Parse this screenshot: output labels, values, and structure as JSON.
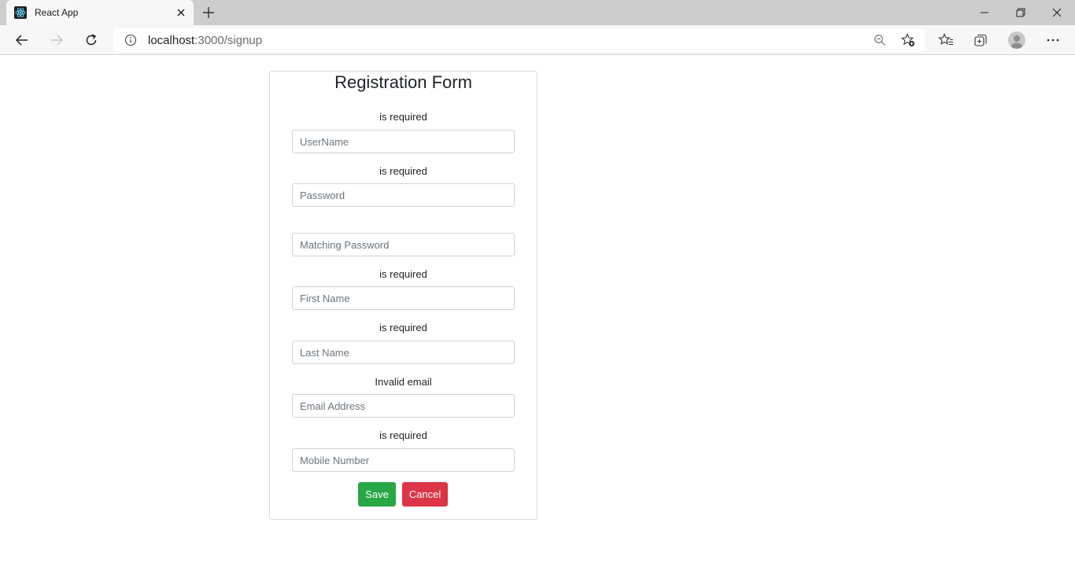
{
  "browser": {
    "tab_title": "React App",
    "url_host": "localhost",
    "url_path": ":3000/signup"
  },
  "form": {
    "title": "Registration Form",
    "fields": [
      {
        "error": "is required",
        "placeholder": "UserName",
        "value": ""
      },
      {
        "error": "is required",
        "placeholder": "Password",
        "value": ""
      },
      {
        "error": "",
        "placeholder": "Matching Password",
        "value": ""
      },
      {
        "error": "is required",
        "placeholder": "First Name",
        "value": ""
      },
      {
        "error": "is required",
        "placeholder": "Last Name",
        "value": ""
      },
      {
        "error": "Invalid email",
        "placeholder": "Email Address",
        "value": ""
      },
      {
        "error": "is required",
        "placeholder": "Mobile Number",
        "value": ""
      }
    ],
    "save_label": "Save",
    "cancel_label": "Cancel",
    "save_color": "#28a745",
    "cancel_color": "#dc3545"
  },
  "icons": [
    "react-logo-icon",
    "close-icon",
    "plus-icon",
    "minimize-icon",
    "restore-icon",
    "close-window-icon",
    "back-icon",
    "forward-icon",
    "refresh-icon",
    "info-icon",
    "zoom-out-icon",
    "add-favorite-icon",
    "favorites-icon",
    "collections-icon",
    "profile-icon",
    "more-icon"
  ]
}
